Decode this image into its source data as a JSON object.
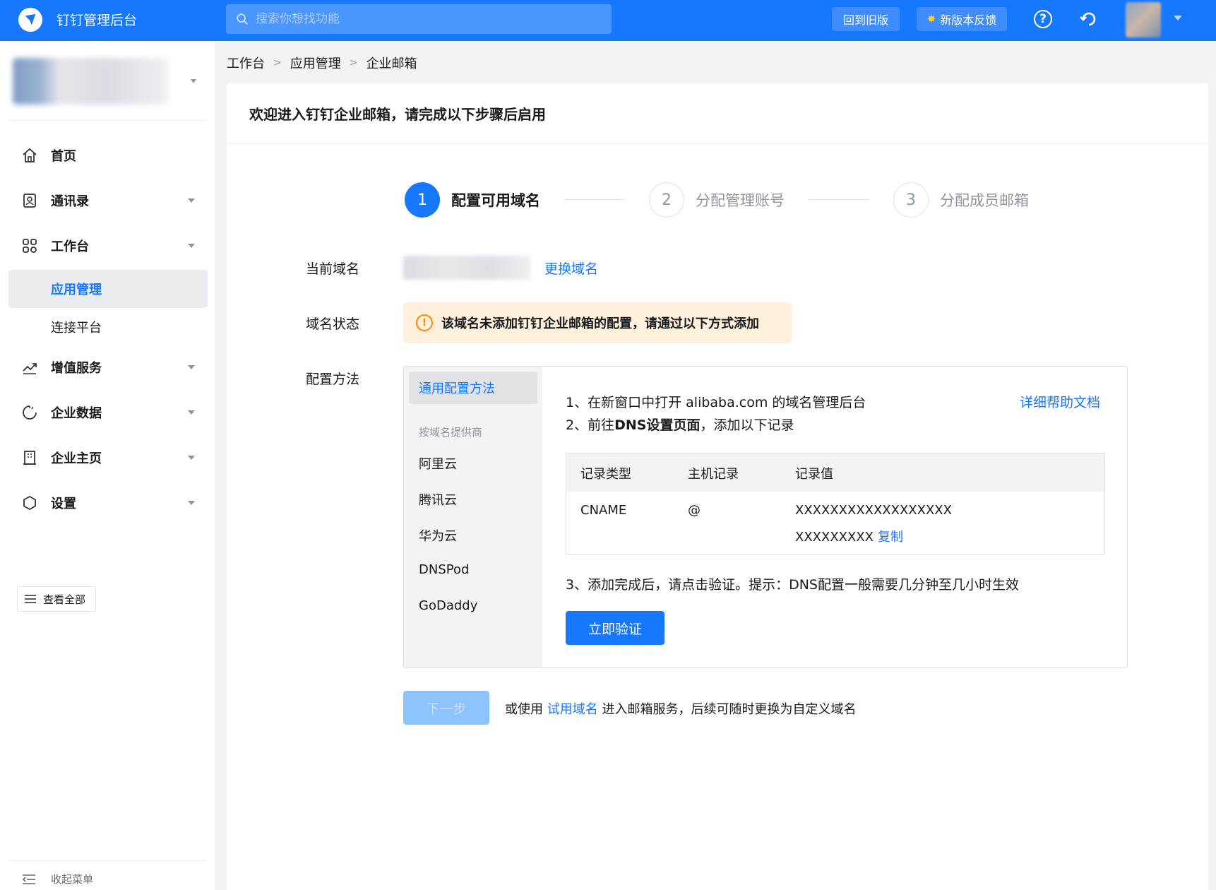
{
  "header": {
    "app_title": "钉钉管理后台",
    "search_placeholder": "搜索你想找功能",
    "back_old_label": "回到旧版",
    "feedback_label": "新版本反馈",
    "help_glyph": "?",
    "brand_color": "#1677ff"
  },
  "sidebar": {
    "nav": [
      {
        "label": "首页",
        "icon": "home-icon"
      },
      {
        "label": "通讯录",
        "icon": "contacts-icon"
      },
      {
        "label": "工作台",
        "icon": "workbench-icon"
      },
      {
        "label": "增值服务",
        "icon": "trend-icon"
      },
      {
        "label": "企业数据",
        "icon": "data-icon"
      },
      {
        "label": "企业主页",
        "icon": "building-icon"
      },
      {
        "label": "设置",
        "icon": "settings-icon"
      }
    ],
    "sub": [
      {
        "label": "应用管理",
        "active": true
      },
      {
        "label": "连接平台",
        "active": false
      }
    ],
    "view_all_label": "查看全部",
    "collapse_label": "收起菜单"
  },
  "breadcrumb": [
    "工作台",
    "应用管理",
    "企业邮箱"
  ],
  "card": {
    "title": "欢迎进入钉钉企业邮箱，请完成以下步骤后启用"
  },
  "steps": [
    {
      "num": "1",
      "label": "配置可用域名",
      "active": true
    },
    {
      "num": "2",
      "label": "分配管理账号",
      "active": false
    },
    {
      "num": "3",
      "label": "分配成员邮箱",
      "active": false
    }
  ],
  "form": {
    "current_domain_label": "当前域名",
    "change_domain_link": "更换域名",
    "domain_status_label": "域名状态",
    "domain_status_glyph": "!",
    "domain_status_text": "该域名未添加钉钉企业邮箱的配置，请通过以下方式添加",
    "config_method_label": "配置方法"
  },
  "config": {
    "general_method": "通用配置方法",
    "provider_heading": "按域名提供商",
    "providers": [
      "阿里云",
      "腾讯云",
      "华为云",
      "DNSPod",
      "GoDaddy"
    ],
    "step1_prefix": "1、在新窗口中打开 ",
    "step1_domain": "alibaba.com",
    "step1_suffix": " 的域名管理后台",
    "step2_prefix": "2、前往",
    "step2_bold": "DNS设置页面",
    "step2_suffix": "，添加以下记录",
    "help_doc_link": "详细帮助文档",
    "table_headers": [
      "记录类型",
      "主机记录",
      "记录值"
    ],
    "record": {
      "type": "CNAME",
      "host": "@",
      "value_line1": "XXXXXXXXXXXXXXXXXX",
      "value_line2": "XXXXXXXXX",
      "copy_label": "复制"
    },
    "step3": "3、添加完成后，请点击验证。提示：DNS配置一般需要几分钟至几小时生效",
    "verify_button": "立即验证"
  },
  "footer_action": {
    "next_button": "下一步",
    "note_prefix": "或使用 ",
    "trial_domain_link": "试用域名",
    "note_suffix": " 进入邮箱服务，后续可随时更换为自定义域名"
  },
  "colors": {
    "warning_bg": "#fff0dc",
    "warning_icon": "#ff8800",
    "link": "#1677ff"
  }
}
